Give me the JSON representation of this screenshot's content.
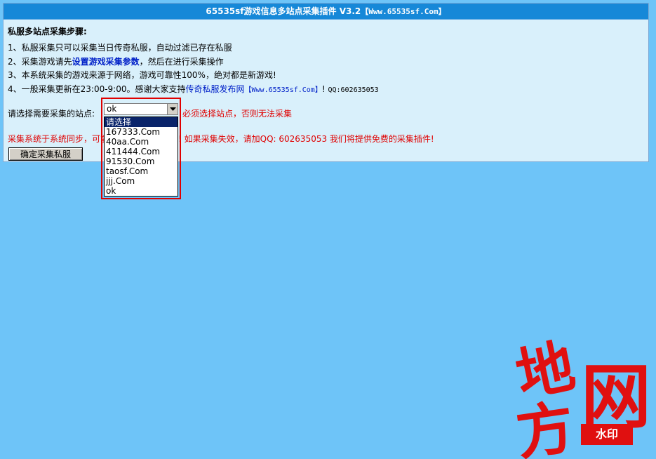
{
  "header": {
    "title": "65535sf游戏信息多站点采集插件 V3.2",
    "url": "【Www.65535sf.Com】"
  },
  "steps": {
    "heading": "私服多站点采集步骤:",
    "s1": "1、私服采集只可以采集当日传奇私服，自动过滤已存在私服",
    "s2_pre": "2、采集游戏请先",
    "s2_link": "设置游戏采集参数",
    "s2_post": "，然后在进行采集操作",
    "s3": "3、本系统采集的游戏来源于网络，游戏可靠性100%，绝对都是新游戏!",
    "s4_pre": "4、一般采集更新在23:00-9:00。感谢大家支持",
    "s4_link": "传奇私服发布网",
    "s4_url": "【Www.65535sf.Com】",
    "s4_post": "! ",
    "s4_qq": "QQ:602635053"
  },
  "site_select": {
    "label": "请选择需要采集的站点:",
    "value": "ok",
    "required_note": "必须选择站点，否则无法采集",
    "options": [
      "请选择",
      "167333.Com",
      "40aa.Com",
      "411444.Com",
      "91530.Com",
      "taosf.Com",
      "jjj.Com",
      "ok"
    ]
  },
  "warning": {
    "before": "采集系统于系统同步，可能",
    "after": "限制! 如果采集失效，请加QQ: 602635053 我们将提供免费的采集插件!"
  },
  "submit_label": "确定采集私服",
  "watermark": {
    "char1": "地",
    "char2": "方",
    "char3": "网",
    "badge": "水印"
  },
  "colors": {
    "header_bg": "#1688d8",
    "page_bg": "#6ec4f8",
    "panel_bg": "#d9f0fb",
    "accent_red": "#e00000",
    "link_blue": "#0020c8"
  }
}
